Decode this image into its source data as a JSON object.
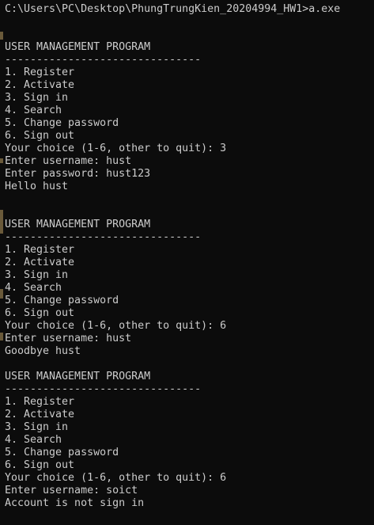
{
  "window": {
    "type": "console"
  },
  "console": {
    "lines": [
      "C:\\Users\\PC\\Desktop\\PhungTrungKien_20204994_HW1>a.exe",
      "",
      "",
      "USER MANAGEMENT PROGRAM",
      "-------------------------------",
      "1. Register",
      "2. Activate",
      "3. Sign in",
      "4. Search",
      "5. Change password",
      "6. Sign out",
      "Your choice (1-6, other to quit): 3",
      "Enter username: hust",
      "Enter password: hust123",
      "Hello hust",
      "",
      "",
      "USER MANAGEMENT PROGRAM",
      "-------------------------------",
      "1. Register",
      "2. Activate",
      "3. Sign in",
      "4. Search",
      "5. Change password",
      "6. Sign out",
      "Your choice (1-6, other to quit): 6",
      "Enter username: hust",
      "Goodbye hust",
      "",
      "USER MANAGEMENT PROGRAM",
      "-------------------------------",
      "1. Register",
      "2. Activate",
      "3. Sign in",
      "4. Search",
      "5. Change password",
      "6. Sign out",
      "Your choice (1-6, other to quit): 6",
      "Enter username: soict",
      "Account is not sign in"
    ]
  },
  "colors": {
    "background": "#0c0c0c",
    "text": "#cccccc"
  }
}
